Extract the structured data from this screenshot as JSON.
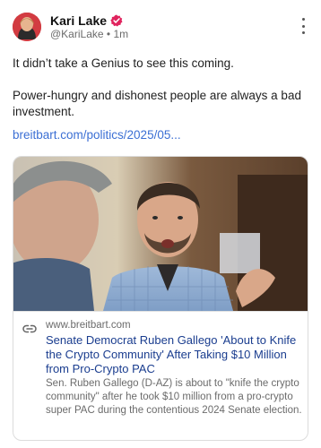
{
  "author": {
    "display_name": "Kari Lake",
    "handle": "@KariLake",
    "separator": "•",
    "time_ago": "1m",
    "avatar_icon": "avatar-portrait",
    "verified_icon": "verified-badge-icon",
    "verified_color": "#e0245e"
  },
  "post": {
    "paragraph_1": "It didn’t take a Genius to see this coming.",
    "paragraph_2": "Power-hungry and dishonest people are always a bad investment.",
    "link_text": "breitbart.com/politics/2025/05...",
    "link_color": "#3b6fd4"
  },
  "card": {
    "image_icon": "news-photo",
    "link_icon": "link-icon",
    "domain": "www.breitbart.com",
    "headline": "Senate Democrat Ruben Gallego 'About to Knife the Crypto Community' After Taking $10 Million from Pro-Crypto PAC",
    "description": "Sen. Ruben Gallego (D-AZ) is about to \"knife the crypto community\" after he took $10 million from a pro-crypto super PAC during the contentious 2024 Senate election."
  },
  "menu": {
    "icon": "more-vertical-icon"
  }
}
